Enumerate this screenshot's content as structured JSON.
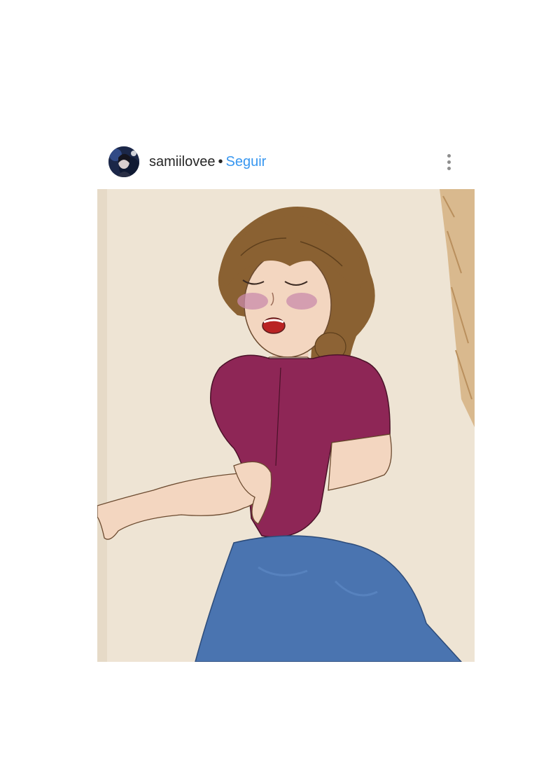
{
  "post": {
    "username": "samiilovee",
    "separator": "•",
    "follow_label": "Seguir",
    "avatar_icon": "profile-avatar",
    "more_icon": "more-options-icon"
  },
  "photo": {
    "subject": "drawing-of-girl-singing",
    "colors": {
      "paper": "#eee4d4",
      "hair": "#8a6132",
      "blouse": "#8e2656",
      "skirt": "#4a74b0",
      "skin": "#f3d6c0",
      "blush": "#c98bab"
    }
  },
  "theme": {
    "link_color": "#3897f0",
    "text_color": "#262626",
    "muted_color": "#8e8e8e"
  }
}
